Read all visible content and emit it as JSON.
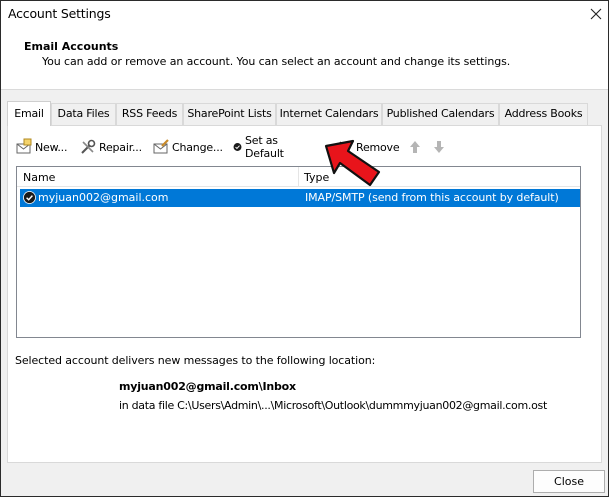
{
  "window": {
    "title": "Account Settings"
  },
  "header": {
    "title": "Email Accounts",
    "description": "You can add or remove an account. You can select an account and change its settings."
  },
  "tabs": [
    {
      "label": "Email",
      "active": true
    },
    {
      "label": "Data Files",
      "active": false
    },
    {
      "label": "RSS Feeds",
      "active": false
    },
    {
      "label": "SharePoint Lists",
      "active": false
    },
    {
      "label": "Internet Calendars",
      "active": false
    },
    {
      "label": "Published Calendars",
      "active": false
    },
    {
      "label": "Address Books",
      "active": false
    }
  ],
  "toolbar": {
    "new_label": "New...",
    "repair_label": "Repair...",
    "change_label": "Change...",
    "set_default_label": "Set as Default",
    "remove_label": "Remove",
    "move_up_icon": "arrow-up-icon",
    "move_down_icon": "arrow-down-icon"
  },
  "accounts_list": {
    "columns": [
      "Name",
      "Type"
    ],
    "rows": [
      {
        "name": "myjuan002@gmail.com",
        "type": "IMAP/SMTP (send from this account by default)",
        "selected": true
      }
    ]
  },
  "delivery": {
    "label": "Selected account delivers new messages to the following location:",
    "folder": "myjuan002@gmail.com\\Inbox",
    "data_file": "in data file C:\\Users\\Admin\\...\\Microsoft\\Outlook\\dummmyjuan002@gmail.com.ost"
  },
  "footer": {
    "close_label": "Close"
  },
  "colors": {
    "selection": "#0078d7",
    "annotation_arrow": "#e8141b"
  }
}
